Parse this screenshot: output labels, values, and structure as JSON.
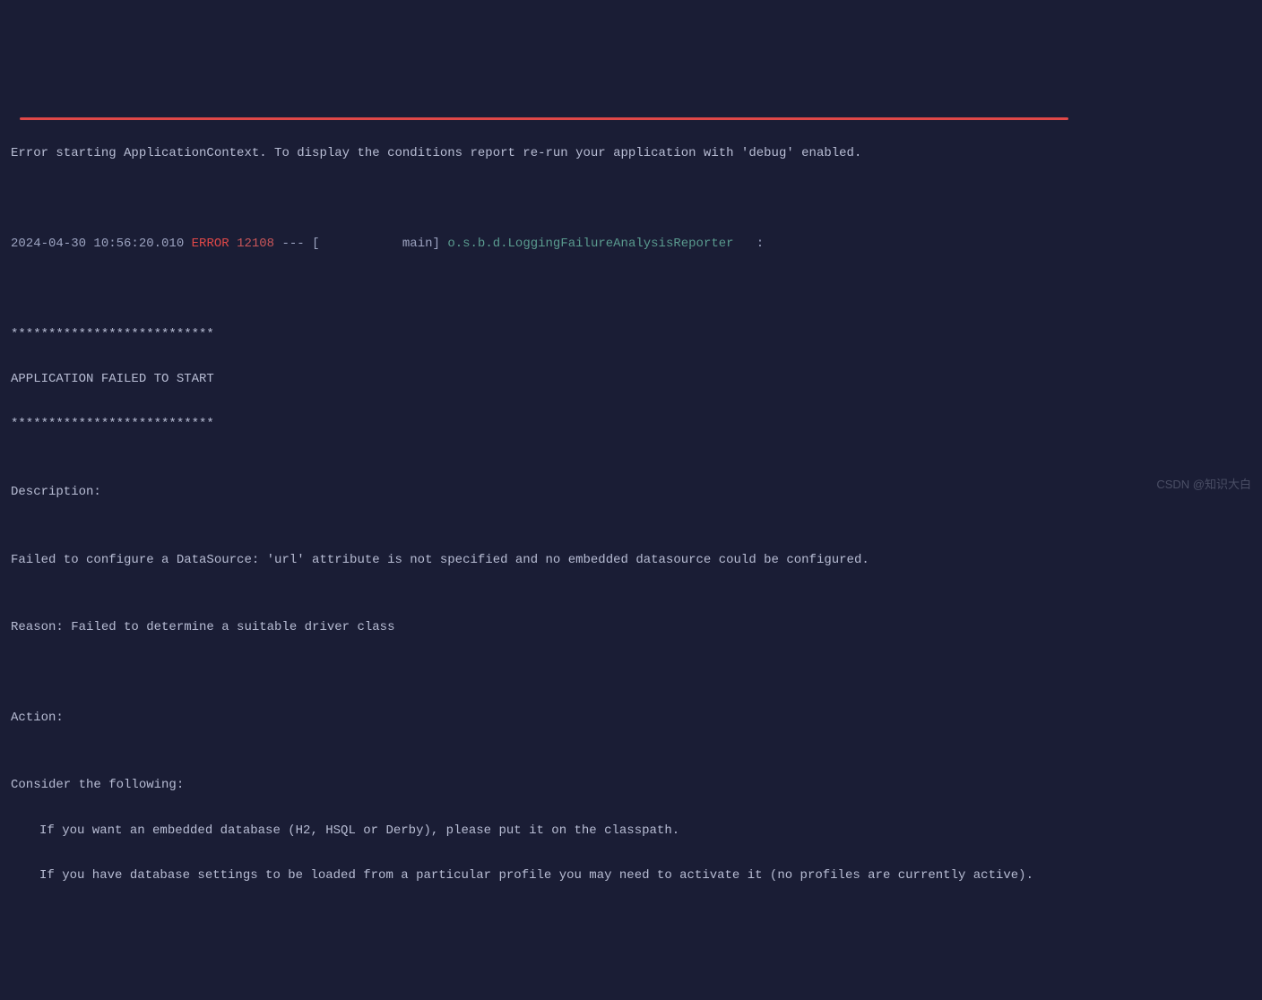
{
  "log": {
    "line1": "Error starting ApplicationContext. To display the conditions report re-run your application with 'debug' enabled.",
    "line2": {
      "timestamp": "2024-04-30 10:56:20.010",
      "level": "ERROR",
      "pid": "12108",
      "separator": " --- [           main] ",
      "logger": "o.s.b.d.LoggingFailureAnalysisReporter",
      "tail": "   :"
    },
    "blank": "",
    "divider": "***************************",
    "failedTitle": "APPLICATION FAILED TO START",
    "descriptionHeader": "Description:",
    "descriptionBody": "Failed to configure a DataSource: 'url' attribute is not specified and no embedded datasource could be configured.",
    "reason": "Reason: Failed to determine a suitable driver class",
    "actionHeader": "Action:",
    "considerHeader": "Consider the following:",
    "considerLine1": "If you want an embedded database (H2, HSQL or Derby), please put it on the classpath.",
    "considerLine2": "If you have database settings to be loaded from a particular profile you may need to activate it (no profiles are currently active)."
  },
  "watermark": "CSDN @知识大白"
}
